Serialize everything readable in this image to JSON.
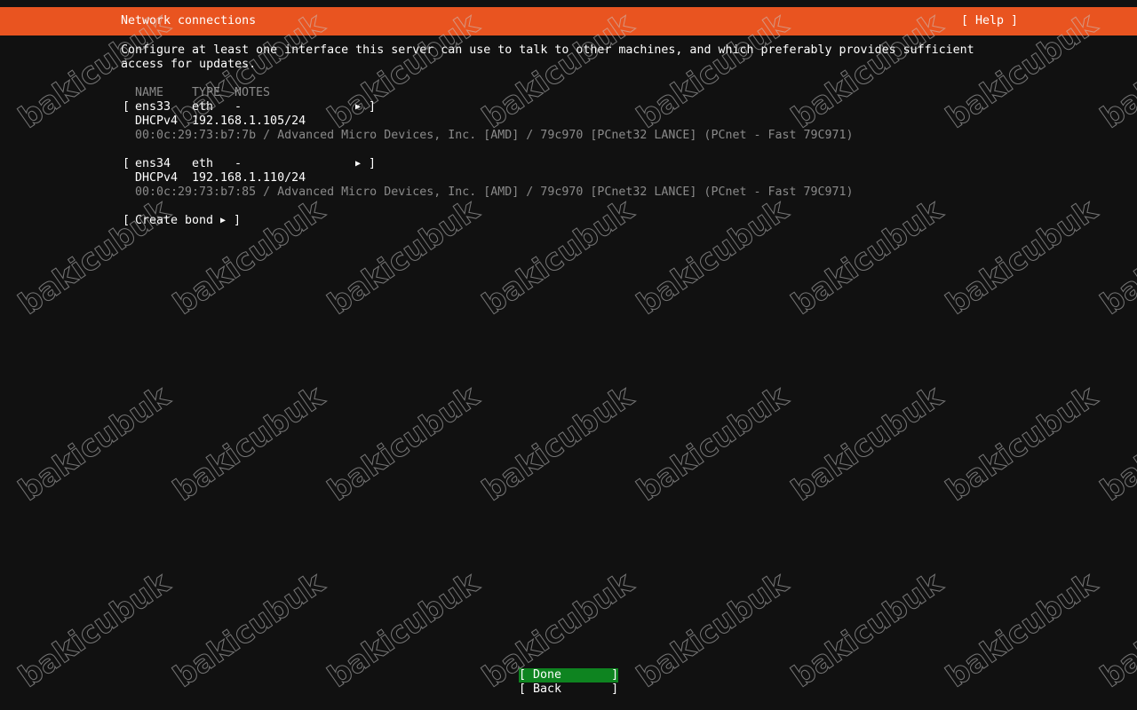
{
  "header": {
    "title": "Network connections",
    "help": "[ Help ]"
  },
  "intro": {
    "line1": "Configure at least one interface this server can use to talk to other machines, and which preferably provides sufficient",
    "line2": "access for updates."
  },
  "columns": {
    "name": "NAME",
    "type": "TYPE",
    "notes": "NOTES"
  },
  "interfaces": [
    {
      "open_bracket": "[",
      "name": "ens33",
      "type": "eth",
      "notes": "-",
      "arrow": "▶",
      "close_bracket": "]",
      "dhcp_label": "DHCPv4",
      "address": "192.168.1.105/24",
      "hw": "00:0c:29:73:b7:7b / Advanced Micro Devices, Inc. [AMD] / 79c970 [PCnet32 LANCE] (PCnet - Fast 79C971)"
    },
    {
      "open_bracket": "[",
      "name": "ens34",
      "type": "eth",
      "notes": "-",
      "arrow": "▶",
      "close_bracket": "]",
      "dhcp_label": "DHCPv4",
      "address": "192.168.1.110/24",
      "hw": "00:0c:29:73:b7:85 / Advanced Micro Devices, Inc. [AMD] / 79c970 [PCnet32 LANCE] (PCnet - Fast 79C971)"
    }
  ],
  "create_bond": {
    "open": "[",
    "label": "Create bond",
    "arrow": "▶",
    "close": "]"
  },
  "buttons": {
    "done": "[ Done       ]",
    "back": "[ Back       ]"
  },
  "watermark": "bakicubuk",
  "colors": {
    "accent": "#e95420",
    "background": "#111111",
    "done_button": "#0e8420",
    "muted_text": "#8a8a8a"
  },
  "icons": {
    "expand": "caret-right-icon"
  }
}
